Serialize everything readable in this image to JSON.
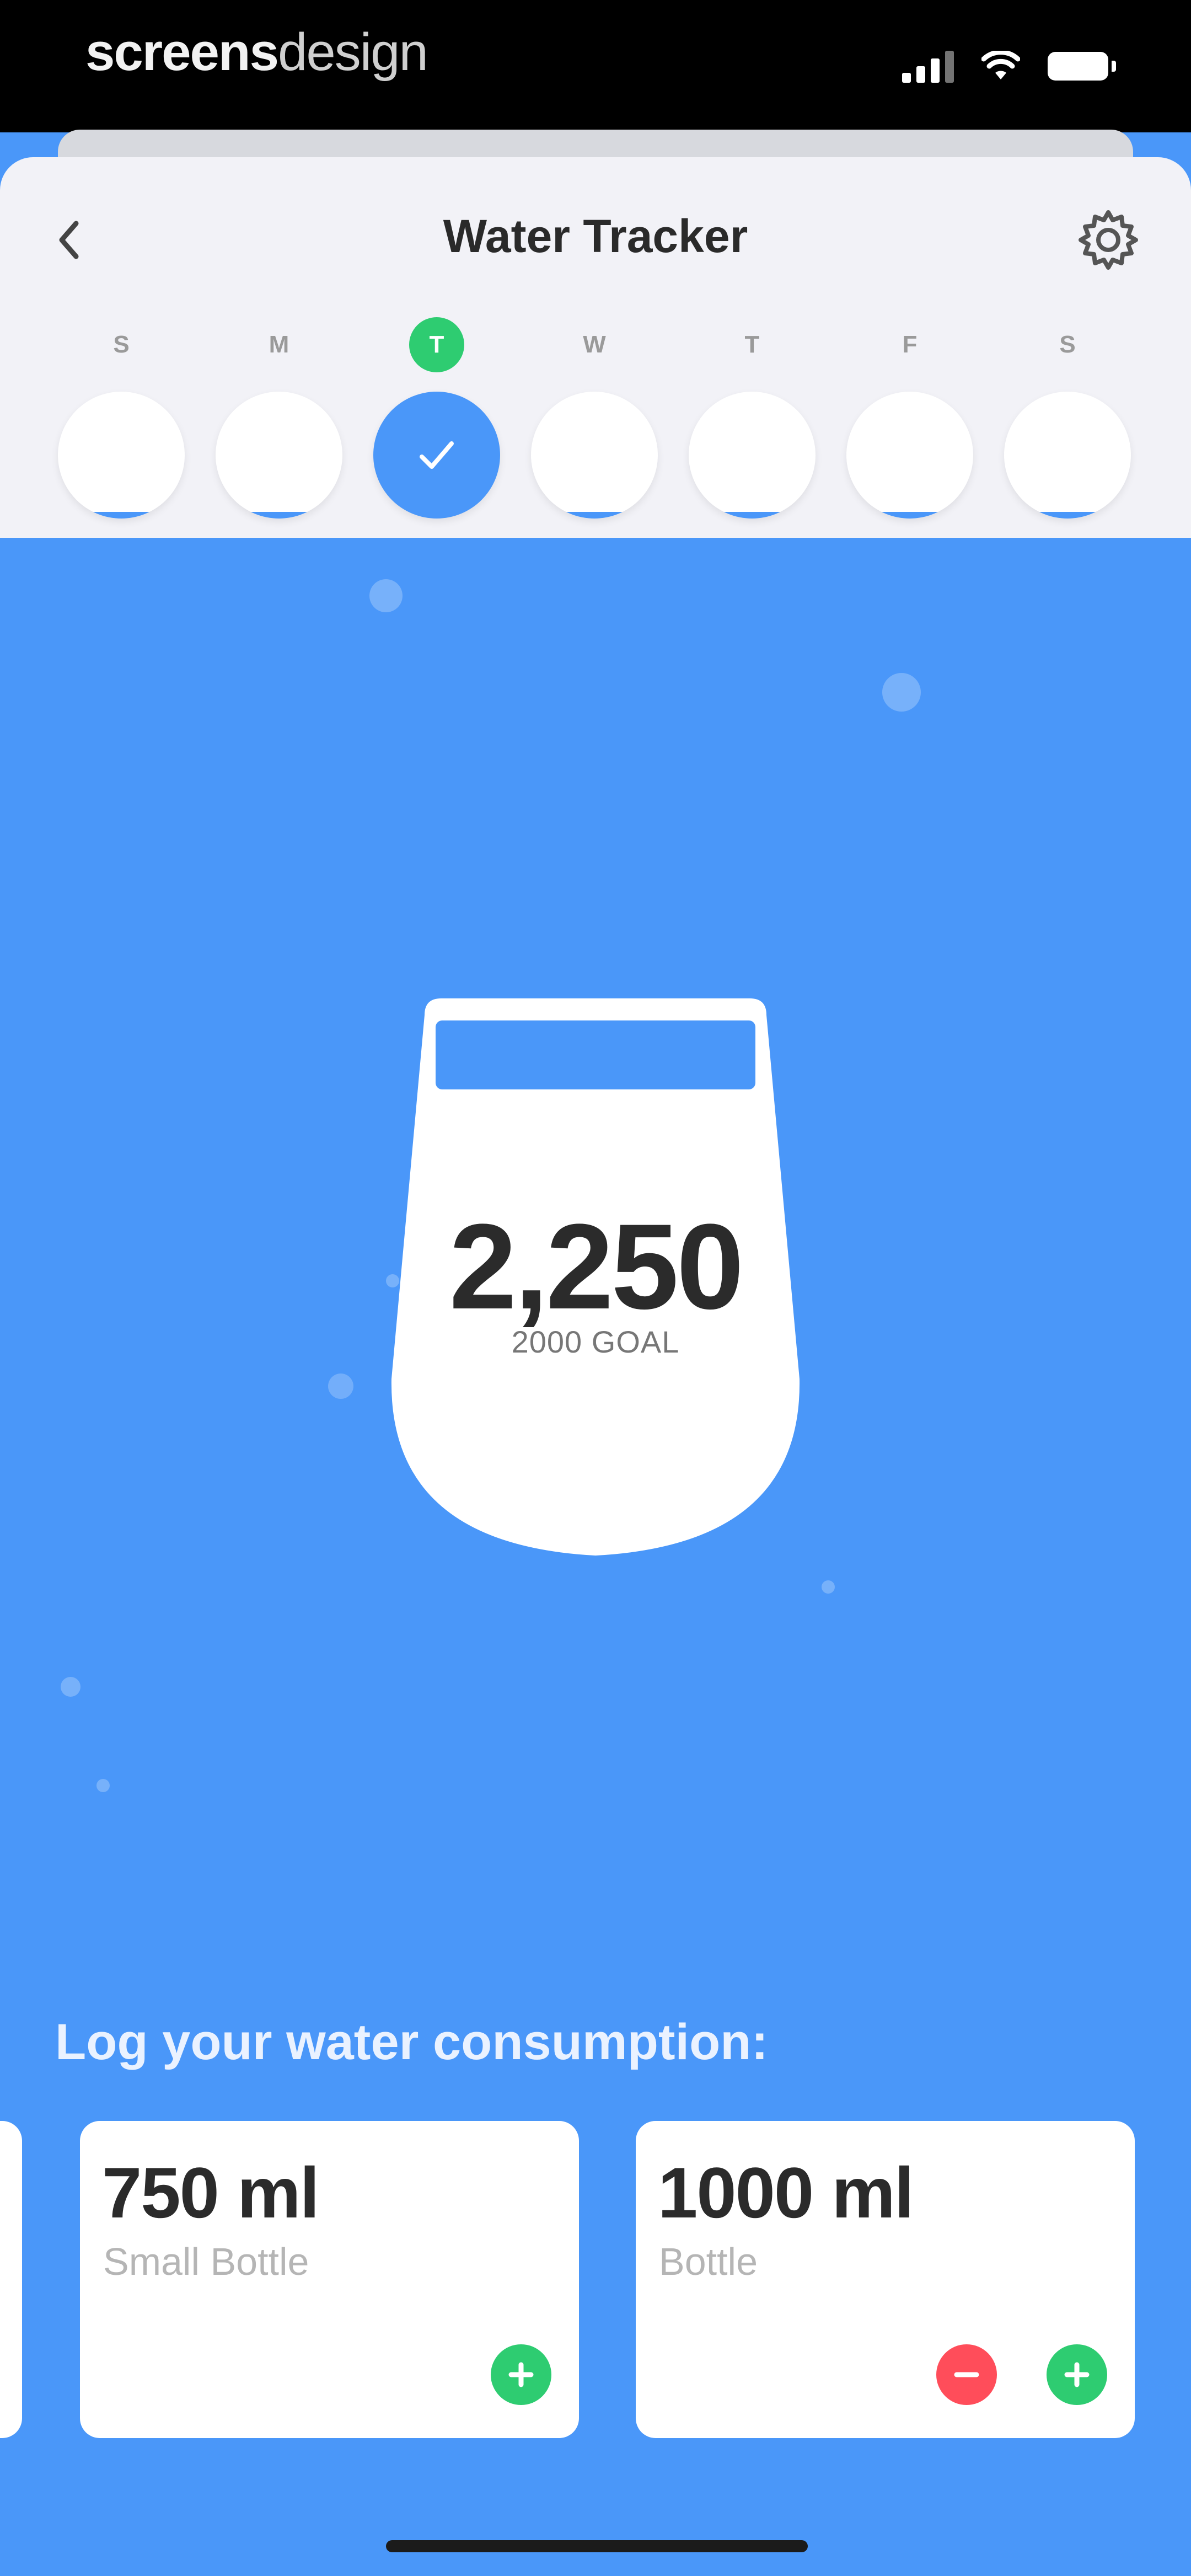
{
  "status_bar": {
    "brand_bold": "screens",
    "brand_light": "design"
  },
  "header": {
    "title": "Water Tracker"
  },
  "week": [
    {
      "letter": "S",
      "today": false,
      "fill": 0.05
    },
    {
      "letter": "M",
      "today": false,
      "fill": 0.05
    },
    {
      "letter": "T",
      "today": true,
      "fill": 1.0
    },
    {
      "letter": "W",
      "today": false,
      "fill": 0.05
    },
    {
      "letter": "T",
      "today": false,
      "fill": 0.05
    },
    {
      "letter": "F",
      "today": false,
      "fill": 0.05
    },
    {
      "letter": "S",
      "today": false,
      "fill": 0.05
    }
  ],
  "glass": {
    "total": "2,250",
    "goal_text": "2000 GOAL",
    "fill_fraction": 0.1
  },
  "log": {
    "title": "Log your water consumption:",
    "cards": [
      {
        "amount": "750 ml",
        "name": "Small Bottle",
        "show_minus": false
      },
      {
        "amount": "1000 ml",
        "name": "Bottle",
        "show_minus": true
      }
    ]
  },
  "colors": {
    "accent_blue": "#4A97F9",
    "green": "#2ECC71",
    "red": "#FF4D5A",
    "header_bg": "#F2F2F7"
  },
  "icons": {
    "back": "chevron-left-icon",
    "settings": "gear-icon",
    "check": "check-icon",
    "add": "plus-icon",
    "remove": "minus-icon"
  }
}
